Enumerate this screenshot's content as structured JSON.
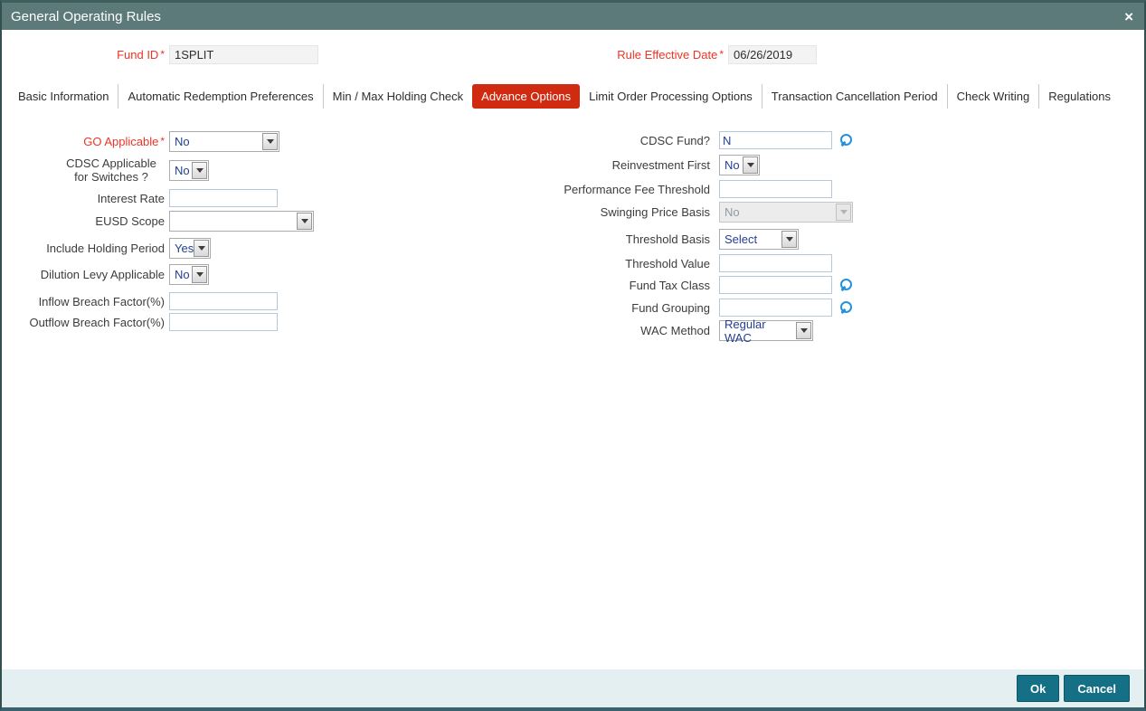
{
  "window": {
    "title": "General Operating Rules"
  },
  "icons": {
    "close": "×",
    "lookup": "magnifier"
  },
  "meta": {
    "required_marker": "*"
  },
  "header": {
    "fund_id": {
      "label": "Fund ID",
      "value": "1SPLIT"
    },
    "rule_effective_date": {
      "label": "Rule Effective Date",
      "value": "06/26/2019"
    }
  },
  "tabs": [
    {
      "label": "Basic Information",
      "selected": false
    },
    {
      "label": "Automatic Redemption Preferences",
      "selected": false
    },
    {
      "label": "Min / Max Holding Check",
      "selected": false
    },
    {
      "label": "Advance Options",
      "selected": true
    },
    {
      "label": "Limit Order Processing Options",
      "selected": false
    },
    {
      "label": "Transaction Cancellation Period",
      "selected": false
    },
    {
      "label": "Check Writing",
      "selected": false
    },
    {
      "label": "Regulations",
      "selected": false
    }
  ],
  "form": {
    "left": [
      {
        "label": "GO Applicable",
        "required": true,
        "type": "select",
        "value": "No"
      },
      {
        "label": "CDSC Applicable for Switches ?",
        "type": "select",
        "value": "No"
      },
      {
        "label": "Interest Rate",
        "type": "input",
        "value": ""
      },
      {
        "label": "EUSD Scope",
        "type": "select",
        "value": ""
      },
      {
        "label": "Include Holding Period",
        "type": "select",
        "value": "Yes"
      },
      {
        "label": "Dilution Levy Applicable",
        "type": "select",
        "value": "No"
      },
      {
        "label": "Inflow Breach Factor(%)",
        "type": "input",
        "value": ""
      },
      {
        "label": "Outflow Breach Factor(%)",
        "type": "input",
        "value": ""
      }
    ],
    "right": [
      {
        "label": "CDSC Fund?",
        "type": "lookup",
        "value": "N"
      },
      {
        "label": "Reinvestment First",
        "type": "select",
        "value": "No"
      },
      {
        "label": "Performance Fee Threshold",
        "type": "input",
        "value": ""
      },
      {
        "label": "Swinging Price Basis",
        "type": "select",
        "value": "No",
        "disabled": true
      },
      {
        "label": "Threshold Basis",
        "type": "select",
        "value": "Select"
      },
      {
        "label": "Threshold Value",
        "type": "input",
        "value": ""
      },
      {
        "label": "Fund Tax Class",
        "type": "lookup",
        "value": ""
      },
      {
        "label": "Fund Grouping",
        "type": "lookup",
        "value": ""
      },
      {
        "label": "WAC Method",
        "type": "select",
        "value": "Regular WAC"
      }
    ]
  },
  "footer": {
    "ok_label": "Ok",
    "cancel_label": "Cancel"
  },
  "colors": {
    "title_bar": "#5d7a7a",
    "selected_tab": "#d02b10",
    "required_label": "#ee3425",
    "field_value_text": "#223f8f",
    "button": "#156f85",
    "footer_bg": "#e4eff2",
    "lookup_icon": "#2491dc"
  }
}
